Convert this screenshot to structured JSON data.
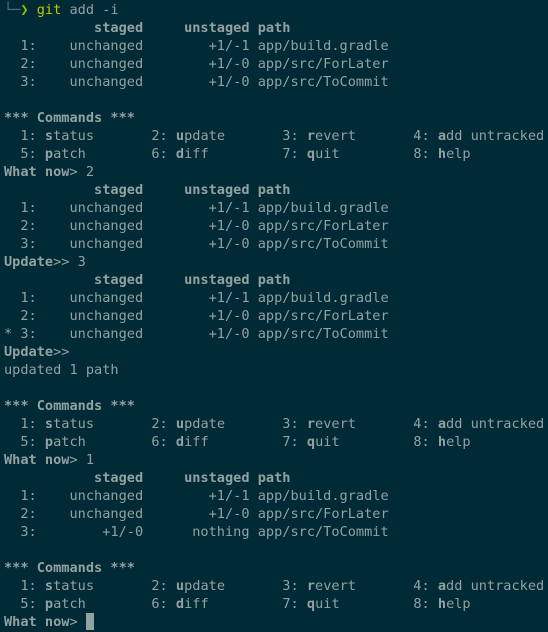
{
  "shell": {
    "prompt_corner": "└─",
    "prompt_arrow": "❯",
    "command": "git",
    "args": "add -i"
  },
  "table_header": {
    "indent": "           ",
    "staged": "staged",
    "gap1": "     ",
    "unstaged": "unstaged",
    "gap2": " ",
    "path": "path"
  },
  "commands_menu": {
    "title": "*** Commands ***",
    "row1": [
      {
        "num": "  1: ",
        "key": "s",
        "rest": "tatus",
        "pad": "       "
      },
      {
        "num": "2: ",
        "key": "u",
        "rest": "pdate",
        "pad": "       "
      },
      {
        "num": "3: ",
        "key": "r",
        "rest": "evert",
        "pad": "       "
      },
      {
        "num": "4: ",
        "key": "a",
        "rest": "dd untracked",
        "pad": ""
      }
    ],
    "row2": [
      {
        "num": "  5: ",
        "key": "p",
        "rest": "atch",
        "pad": "        "
      },
      {
        "num": "6: ",
        "key": "d",
        "rest": "iff",
        "pad": "         "
      },
      {
        "num": "7: ",
        "key": "q",
        "rest": "uit",
        "pad": "         "
      },
      {
        "num": "8: ",
        "key": "h",
        "rest": "elp",
        "pad": ""
      }
    ]
  },
  "status1": [
    "  1:    unchanged        +1/-1 app/build.gradle",
    "  2:    unchanged        +1/-0 app/src/ForLater",
    "  3:    unchanged        +1/-0 app/src/ToCommit"
  ],
  "prompt_what_now_1": {
    "label": "What now",
    "sep": "> ",
    "input": "2"
  },
  "update_list_1": [
    "  1:    unchanged        +1/-1 app/build.gradle",
    "  2:    unchanged        +1/-0 app/src/ForLater",
    "  3:    unchanged        +1/-0 app/src/ToCommit"
  ],
  "prompt_update_1": {
    "label": "Update",
    "sep": ">> ",
    "input": "3"
  },
  "update_list_2": [
    "  1:    unchanged        +1/-1 app/build.gradle",
    "  2:    unchanged        +1/-0 app/src/ForLater",
    "* 3:    unchanged        +1/-0 app/src/ToCommit"
  ],
  "prompt_update_2": {
    "label": "Update",
    "sep": ">>",
    "input": ""
  },
  "updated_message": "updated 1 path",
  "prompt_what_now_2": {
    "label": "What now",
    "sep": "> ",
    "input": "1"
  },
  "status2": [
    "  1:    unchanged        +1/-1 app/build.gradle",
    "  2:    unchanged        +1/-0 app/src/ForLater",
    "  3:        +1/-0      nothing app/src/ToCommit"
  ],
  "prompt_what_now_3": {
    "label": "What now",
    "sep": "> ",
    "input": ""
  },
  "colors": {
    "background": "#002b36",
    "text": "#93a1a1",
    "prompt_arrow": "#85c400",
    "git_command": "#b5c900"
  }
}
